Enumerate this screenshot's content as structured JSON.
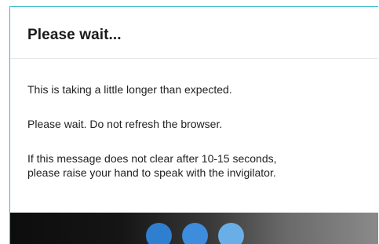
{
  "dialog": {
    "title": "Please wait...",
    "messages": [
      "This is taking a little longer than expected.",
      "Please wait. Do not refresh the browser.",
      "If this message does not clear after 10-15 seconds,",
      "please raise your hand to speak with the invigilator."
    ]
  },
  "loader": {
    "dots": [
      {
        "icon": "loading-dot-icon",
        "color": "#2f7fd0"
      },
      {
        "icon": "loading-dot-icon",
        "color": "#3e8cdc"
      },
      {
        "icon": "loading-dot-icon",
        "color": "#6aaee8"
      }
    ]
  },
  "colors": {
    "border_accent": "#31b9c9",
    "title_text": "#1a1a1a",
    "body_text": "#222222"
  }
}
